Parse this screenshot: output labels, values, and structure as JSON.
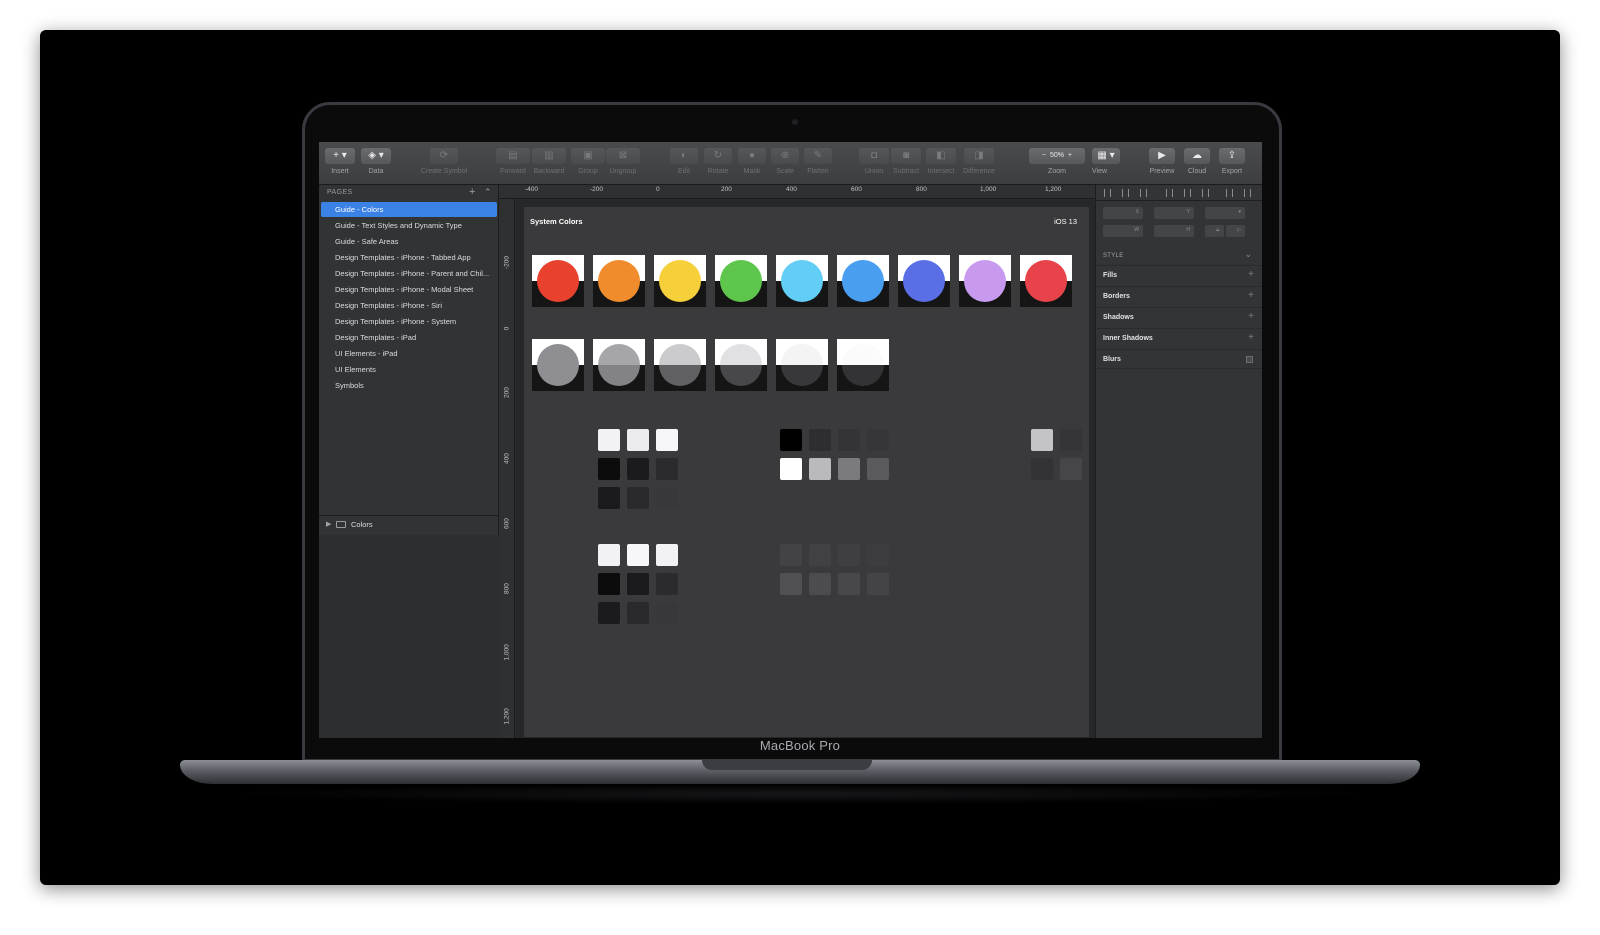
{
  "device": {
    "brand_label": "MacBook Pro"
  },
  "toolbar": {
    "insert": "Insert",
    "data": "Data",
    "create_symbol": "Create Symbol",
    "forward": "Forward",
    "backward": "Backward",
    "group": "Group",
    "ungroup": "Ungroup",
    "edit": "Edit",
    "rotate": "Rotate",
    "mask": "Mask",
    "scale": "Scale",
    "flatten": "Flatten",
    "union": "Union",
    "subtract": "Subtract",
    "intersect": "Intersect",
    "difference": "Difference",
    "zoom_label": "Zoom",
    "zoom_value": "50%",
    "view": "View",
    "preview": "Preview",
    "cloud": "Cloud",
    "export": "Export"
  },
  "sidebar": {
    "pages_header": "PAGES",
    "pages": [
      {
        "label": "Guide - Colors",
        "selected": true
      },
      {
        "label": "Guide - Text Styles and Dynamic Type"
      },
      {
        "label": "Guide - Safe Areas"
      },
      {
        "label": "Design Templates - iPhone - Tabbed App"
      },
      {
        "label": "Design Templates - iPhone - Parent and Chil..."
      },
      {
        "label": "Design Templates - iPhone - Modal Sheet"
      },
      {
        "label": "Design Templates - iPhone - Siri"
      },
      {
        "label": "Design Templates - iPhone - System"
      },
      {
        "label": "Design Templates - iPad"
      },
      {
        "label": "UI Elements - iPad"
      },
      {
        "label": "UI Elements"
      },
      {
        "label": "Symbols"
      }
    ],
    "layer": "Colors"
  },
  "rulers": {
    "top": [
      "-400",
      "-200",
      "0",
      "200",
      "400",
      "600",
      "800",
      "1,000",
      "1,200"
    ],
    "left": [
      "-200",
      "0",
      "200",
      "400",
      "600",
      "800",
      "1,000",
      "1,200"
    ]
  },
  "artboard": {
    "title": "System Colors",
    "platform": "iOS 13",
    "colors": {
      "red": "#e8412d",
      "orange": "#f08c2c",
      "yellow": "#f6d03a",
      "green": "#5ec64c",
      "teal": "#62cdf5",
      "blue": "#4a9ef0",
      "indigo": "#5a6ee6",
      "purple": "#c79af0",
      "pink": "#e8434a"
    }
  },
  "inspector": {
    "x": "X",
    "y": "Y",
    "w": "W",
    "h": "H",
    "style_header": "STYLE",
    "fills": "Fills",
    "borders": "Borders",
    "shadows": "Shadows",
    "inner_shadows": "Inner Shadows",
    "blurs": "Blurs"
  }
}
